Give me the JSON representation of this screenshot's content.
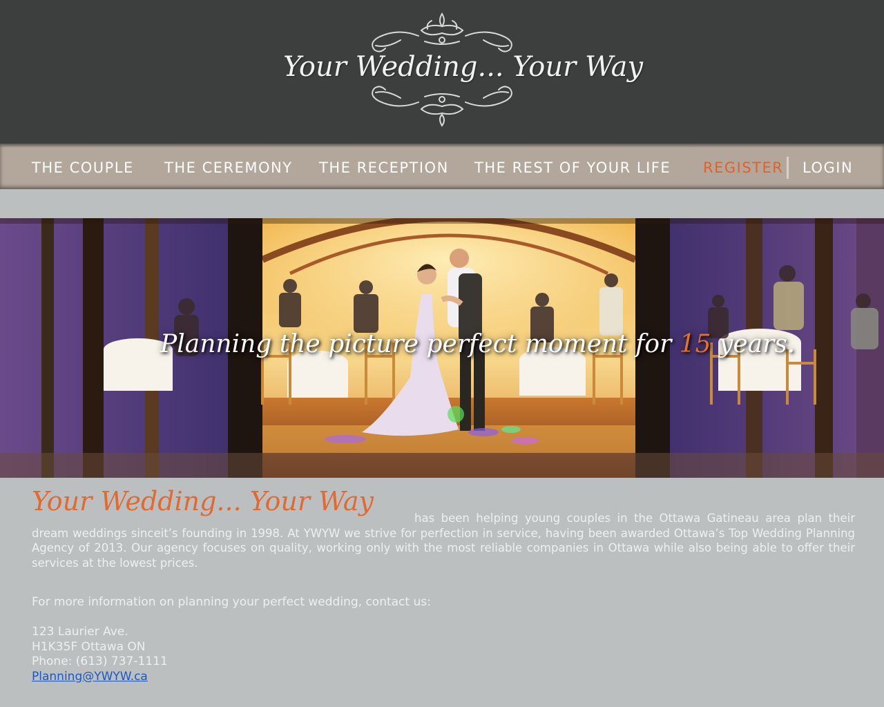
{
  "brand": {
    "logo_text": "Your Wedding... Your Way",
    "colors": {
      "header_bg": "#3d3e3e",
      "nav_bg": "#b3a79b",
      "accent": "#e0622a",
      "page_bg": "#bcbfbf",
      "link": "#1b57c9"
    }
  },
  "nav": {
    "items": [
      {
        "label": "THE COUPLE"
      },
      {
        "label": "THE CEREMONY"
      },
      {
        "label": "THE RECEPTION"
      },
      {
        "label": "THE REST OF YOUR LIFE"
      }
    ],
    "register_label": "REGISTER",
    "login_label": "LOGIN"
  },
  "hero": {
    "tagline_part1": "Planning the picture perfect moment for ",
    "tagline_number": "15",
    "tagline_part2": " years."
  },
  "content": {
    "brand_title": "Your Wedding... Your Way",
    "intro_text": "has been helping young couples in the Ottawa Gatineau area plan their dream weddings sinceit’s founding in 1998. At YWYW we strive for perfection in service, having been awarded Ottawa’s Top Wedding Planning Agency of 2013. Our agency focuses on quality, working only with the most reliable companies in Ottawa while also being able to offer their services at the lowest prices.",
    "contact_prompt": "For more information on planning your perfect wedding, contact us:",
    "address_line1": "123 Laurier Ave.",
    "address_line2": "H1K35F Ottawa ON",
    "phone": "Phone: (613) 737-1111",
    "email": "Planning@YWYW.ca"
  }
}
